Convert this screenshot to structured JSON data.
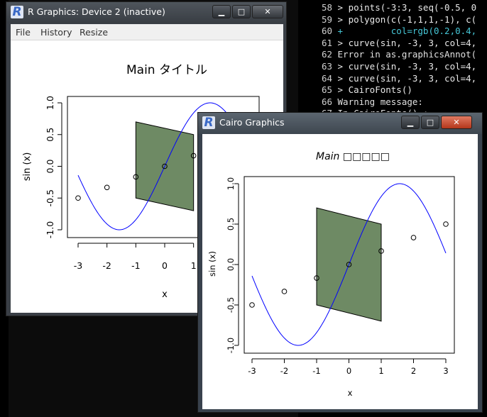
{
  "console": {
    "lines": [
      {
        "num": "58",
        "text": "> points(-3:3, seq(-0.5, 0",
        "kind": "cmd"
      },
      {
        "num": "59",
        "text": "> polygon(c(-1,1,1,-1), c(",
        "kind": "cmd"
      },
      {
        "num": "60",
        "text": "+         col=rgb(0.2,0.4,",
        "kind": "cont"
      },
      {
        "num": "61",
        "text": "> curve(sin, -3, 3, col=4,",
        "kind": "cmd"
      },
      {
        "num": "62",
        "text": "Error in as.graphicsAnnot(",
        "kind": "err"
      },
      {
        "num": "63",
        "text": "> curve(sin, -3, 3, col=4,",
        "kind": "cmd"
      },
      {
        "num": "64",
        "text": "> curve(sin, -3, 3, col=4,",
        "kind": "cmd"
      },
      {
        "num": "65",
        "text": "> CairoFonts()",
        "kind": "cmd"
      },
      {
        "num": "66",
        "text": "Warning message:",
        "kind": "err"
      },
      {
        "num": "67",
        "text": "In CairoFonts() :",
        "kind": "err"
      }
    ]
  },
  "window1": {
    "title": "R Graphics: Device 2 (inactive)",
    "icon": "r-logo-icon",
    "menu": [
      "File",
      "History",
      "Resize"
    ],
    "controls": {
      "minimize": "▁",
      "maximize": "□",
      "close": "✕"
    },
    "plot": {
      "title": "Main タイトル",
      "xlabel": "x",
      "ylabel": "sin (x)",
      "xticks": [
        "-3",
        "-2",
        "-1",
        "0",
        "1"
      ],
      "yticks": [
        "-1.0",
        "-0.5",
        "0.0",
        "0.5",
        "1.0"
      ]
    }
  },
  "window2": {
    "title": "Cairo Graphics",
    "icon": "r-logo-icon",
    "controls": {
      "minimize": "▁",
      "maximize": "□",
      "close": "✕"
    },
    "plot": {
      "title": "Main □□□□□",
      "xlabel": "x",
      "ylabel": "sin (x)",
      "xticks": [
        "-3",
        "-2",
        "-1",
        "0",
        "1",
        "2",
        "3"
      ],
      "yticks": [
        "-1.0",
        "-0.5",
        "0.0",
        "0.5",
        "1.0"
      ]
    }
  },
  "chart_data": [
    {
      "type": "line",
      "title": "Main タイトル",
      "xlabel": "x",
      "ylabel": "sin (x)",
      "xlim": [
        -3,
        3
      ],
      "ylim": [
        -1,
        1
      ],
      "series": [
        {
          "kind": "curve",
          "function": "sin",
          "from": -3,
          "to": 3,
          "color": "#0000ff"
        }
      ],
      "points": {
        "x": [
          -3,
          -2,
          -1,
          0,
          1,
          2,
          3
        ],
        "y": [
          -0.5,
          -0.333,
          -0.167,
          0,
          0.167,
          0.333,
          0.5
        ]
      },
      "polygon": {
        "x": [
          -1,
          1,
          1,
          -1
        ],
        "y": [
          -0.5,
          -0.7,
          0.5,
          0.7
        ],
        "fill": "#6e8a64"
      }
    },
    {
      "type": "line",
      "title": "Main □□□□□",
      "xlabel": "x",
      "ylabel": "sin (x)",
      "xlim": [
        -3,
        3
      ],
      "ylim": [
        -1,
        1
      ],
      "series": [
        {
          "kind": "curve",
          "function": "sin",
          "from": -3,
          "to": 3,
          "color": "#0000ff"
        }
      ],
      "points": {
        "x": [
          -3,
          -2,
          -1,
          0,
          1,
          2,
          3
        ],
        "y": [
          -0.5,
          -0.333,
          -0.167,
          0,
          0.167,
          0.333,
          0.5
        ]
      },
      "polygon": {
        "x": [
          -1,
          1,
          1,
          -1
        ],
        "y": [
          -0.5,
          -0.7,
          0.5,
          0.7
        ],
        "fill": "#6e8a64"
      }
    }
  ]
}
